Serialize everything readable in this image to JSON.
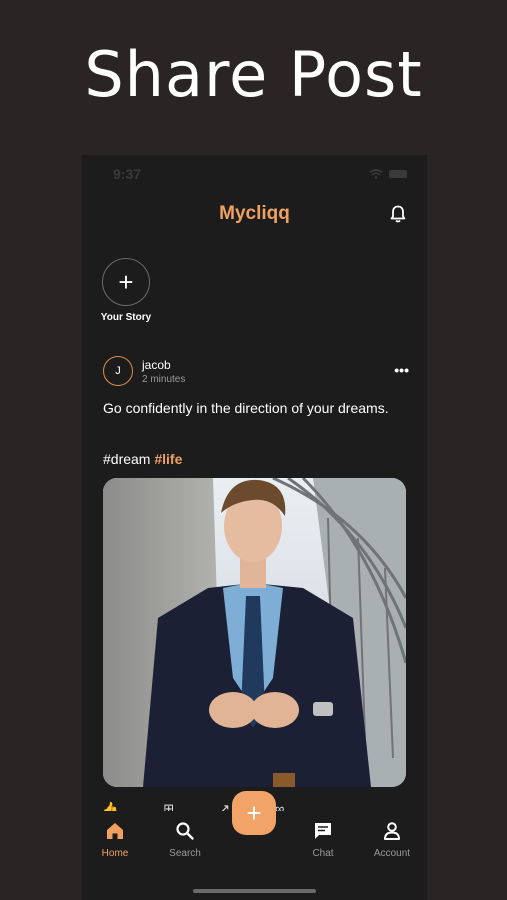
{
  "banner": {
    "title": "Share Post"
  },
  "status_bar": {
    "time": "9:37"
  },
  "app_bar": {
    "title": "Mycliqq"
  },
  "story": {
    "label": "Your Story"
  },
  "post": {
    "avatar_initial": "J",
    "author": "jacob",
    "time_ago": "2 minutes",
    "text": "Go confidently in the direction of your dreams.",
    "hashtag_plain": "#dream",
    "hashtag_highlight": "#life"
  },
  "bottom_nav": {
    "items": [
      {
        "label": "Home",
        "icon": "home-icon",
        "active": true
      },
      {
        "label": "Search",
        "icon": "search-icon",
        "active": false
      },
      {
        "label": "Chat",
        "icon": "chat-icon",
        "active": false
      },
      {
        "label": "Account",
        "icon": "account-icon",
        "active": false
      }
    ],
    "fab_icon": "plus-icon"
  },
  "colors": {
    "accent": "#f0a060",
    "background": "#1d1c1c",
    "outer_background": "#2a2524"
  }
}
